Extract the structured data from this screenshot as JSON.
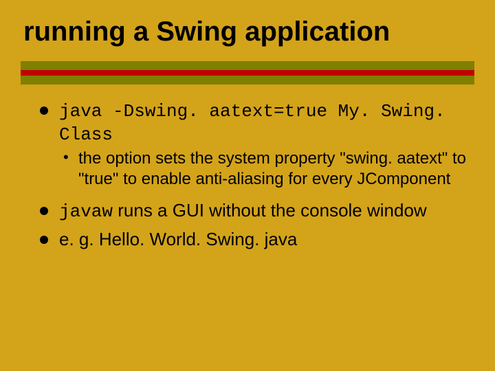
{
  "title": "running a Swing application",
  "bullets": {
    "b1_code": "java -Dswing. aatext=true My. Swing. Class",
    "b1_sub": "the option sets the system property \"swing. aatext\" to \"true\" to enable anti-aliasing for every JComponent",
    "b2_code": "javaw",
    "b2_rest": " runs a GUI without the console window",
    "b3": "e. g. Hello. World. Swing. java"
  }
}
